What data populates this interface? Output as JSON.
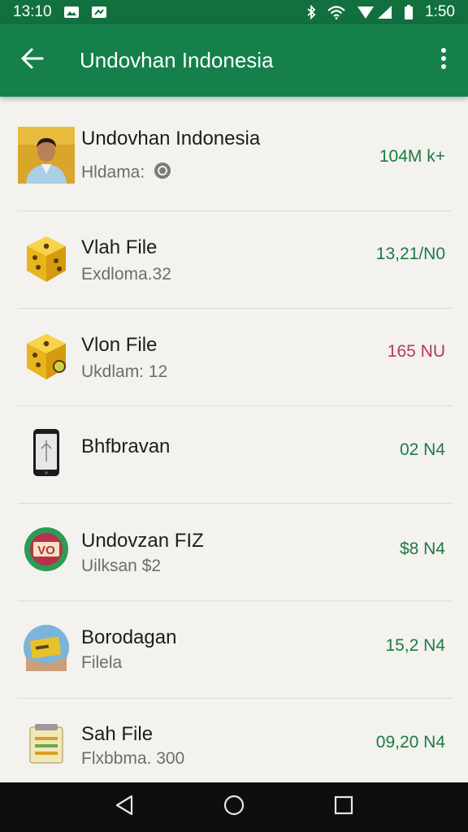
{
  "status_bar": {
    "time_left": "13:10",
    "time_right": "1:50",
    "icons_left": [
      "photo-icon",
      "image-icon"
    ],
    "icons_right": [
      "bluetooth-icon",
      "wifi-icon",
      "signal-icon",
      "battery-icon"
    ]
  },
  "app_bar": {
    "title": "Undovhan Indonesia",
    "back_icon": "arrow-back-icon",
    "menu_icon": "more-vert-icon",
    "color": "#15804a"
  },
  "list": {
    "items": [
      {
        "title": "Undovhan Indonesia",
        "subtitle": "Hldama:",
        "value": "104M k+",
        "icon": "person-photo"
      },
      {
        "title": "Vlah File",
        "subtitle": "Exdloma.32",
        "value": "13,21/N0",
        "icon": "dice-icon"
      },
      {
        "title": "Vlon File",
        "subtitle": "Ukdlam: 12",
        "value": "165 NU",
        "icon": "dice-icon"
      },
      {
        "title": "Bhfbravan",
        "subtitle": "",
        "value": "02 N4",
        "icon": "phone-icon"
      },
      {
        "title": "Undovzan FIZ",
        "subtitle": "Uilksan $2",
        "value": "$8 N4",
        "icon": "vo-badge-icon"
      },
      {
        "title": "Borodagan",
        "subtitle": "Filela",
        "value": "15,2 N4",
        "icon": "card-icon"
      },
      {
        "title": "Sah File",
        "subtitle": "Flxbbma. 300",
        "value": "09,20 N4",
        "icon": "notepad-icon"
      }
    ]
  },
  "nav_bar": {
    "icons": [
      "nav-back-icon",
      "nav-home-icon",
      "nav-recents-icon"
    ]
  },
  "colors": {
    "accent": "#15804a",
    "value_green": "#1d7a46",
    "value_pink": "#b03b62"
  }
}
